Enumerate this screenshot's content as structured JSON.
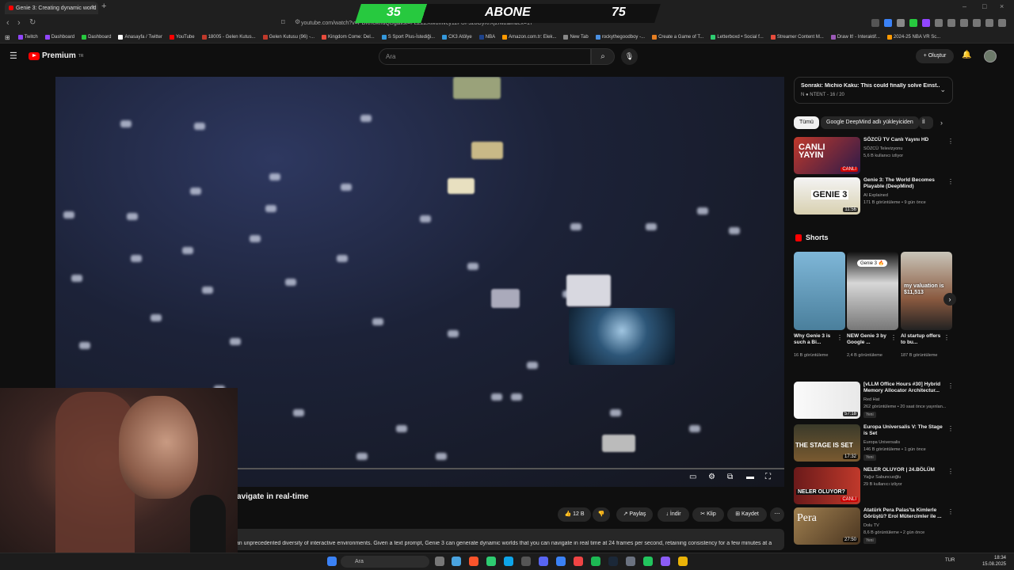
{
  "browser": {
    "tab_title": "Genie 3: Creating dynamic world",
    "url": "youtube.com/watch?v=PDKhUknuQDg&list=PLZ2ZXM0fnvcy1zPUF5z8GyKrXj2rwz&index=17",
    "bookmarks": [
      {
        "label": "Twitch",
        "color": "#9146ff"
      },
      {
        "label": "Dashboard",
        "color": "#9146ff"
      },
      {
        "label": "Dashboard",
        "color": "#27c93f"
      },
      {
        "label": "Anasayfa / Twitter",
        "color": "#ffffff"
      },
      {
        "label": "YouTube",
        "color": "#ff0000"
      },
      {
        "label": "18005 - Gelen Kutus...",
        "color": "#c0392b"
      },
      {
        "label": "Gelen Kutusu (96) -...",
        "color": "#c0392b"
      },
      {
        "label": "Kingdom Come: Del...",
        "color": "#e74c3c"
      },
      {
        "label": "S Sport Plus-İstediği...",
        "color": "#3498db"
      },
      {
        "label": "CK3 Atölye",
        "color": "#3498db"
      },
      {
        "label": "NBA",
        "color": "#1d428a"
      },
      {
        "label": "Amazon.com.tr: Elek...",
        "color": "#ff9900"
      },
      {
        "label": "New Tab",
        "color": "#888888"
      },
      {
        "label": "rockythegoodboy -...",
        "color": "#4a90e2"
      },
      {
        "label": "Create a Game of T...",
        "color": "#e67e22"
      },
      {
        "label": "Letterboxd • Social f...",
        "color": "#2ecc71"
      },
      {
        "label": "Streamer Content M...",
        "color": "#e74c3c"
      },
      {
        "label": "Draw It! - Interaktif...",
        "color": "#9b59b6"
      },
      {
        "label": "2024-25 NBA VR Sc...",
        "color": "#ff9900"
      }
    ]
  },
  "overlay": {
    "left_count": "35",
    "label": "ABONE",
    "right_count": "75",
    "progress_fraction": 0.4667
  },
  "youtube": {
    "logo_text": "Premium",
    "logo_sup": "TR",
    "search_placeholder": "Ara",
    "create_label": "Oluştur",
    "video_title": "...you can navigate in real-time",
    "likes": "12 B",
    "share": "Paylaş",
    "download": "İndir",
    "clip": "Klip",
    "save": "Kaydet",
    "description": "...an unprecedented diversity of interactive environments. Given a text prompt, Genie 3 can generate dynamic worlds that you can navigate in real time at 24 frames per second, retaining consistency for a few minutes at a"
  },
  "sidebar": {
    "next_up_title": "Sonraki: Michio Kaku: This could finally solve Einst...",
    "next_up_sub": "N ● NTENT - 16 / 20",
    "chips": [
      "Tümü",
      "Google DeepMind adlı yükleyiciden",
      "İl"
    ],
    "videos_top": [
      {
        "title": "SÖZCÜ TV Canlı Yayını HD",
        "channel": "SÖZCÜ Televizyonu",
        "meta": "5,6 B kullanıcı izliyor",
        "duration": "",
        "badge": "CANLI",
        "thumb_text": "CANLI YAYIN"
      },
      {
        "title": "Genie 3: The World Becomes Playable (DeepMind)",
        "channel": "AI Explained",
        "meta": "171 B görüntüleme • 9 gün önce",
        "duration": "11:56",
        "badge": "",
        "thumb_text": "GENIE 3"
      }
    ],
    "shorts_label": "Shorts",
    "shorts": [
      {
        "title": "Why Genie 3 is such a Bi...",
        "views": "16 B görüntüleme",
        "thumb_text": ""
      },
      {
        "title": "NEW Genie 3 by Google ...",
        "views": "2,4 B görüntüleme",
        "thumb_text": "Genie 3 🔥"
      },
      {
        "title": "AI startup offers to bu...",
        "views": "187 B görüntüleme",
        "thumb_text": "my valuation is $11,513"
      }
    ],
    "videos_bottom": [
      {
        "title": "[vLLM Office Hours #30] Hybrid Memory Allocator Architectur...",
        "channel": "Red Hat",
        "meta": "262 görüntüleme • 20 saat önce yayınlan...",
        "duration": "57:18",
        "badge": "Yeni",
        "thumb_text": ""
      },
      {
        "title": "Europa Universalis V: The Stage is Set",
        "channel": "Europa Universalis",
        "meta": "146 B görüntüleme • 1 gün önce",
        "duration": "17:32",
        "badge": "Yeni",
        "thumb_text": "THE STAGE IS SET"
      },
      {
        "title": "NELER OLUYOR | 24.BÖLÜM",
        "channel": "Yağız Sabuncuoğlu",
        "meta": "29 B kullanıcı izliyor",
        "duration": "",
        "badge": "CANLI",
        "thumb_text": "NELER OLUYOR?"
      },
      {
        "title": "Atatürk Pera Palas'ta Kimlerle Görüştü? Erol Mütercimler ile ...",
        "channel": "Dolu TV",
        "meta": "8,6 B görüntüleme • 2 gün önce",
        "duration": "27:50",
        "badge": "Yeni",
        "thumb_text": "Pera"
      }
    ]
  },
  "taskbar": {
    "search": "Ara",
    "lang": "TUR",
    "time": "18:34",
    "date": "15.08.2025"
  }
}
